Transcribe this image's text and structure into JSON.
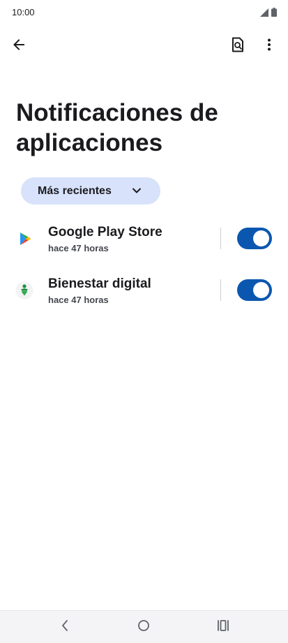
{
  "status_bar": {
    "time": "10:00",
    "icons": [
      "signal-icon",
      "battery-icon"
    ]
  },
  "top_bar": {
    "back_icon": "arrow-back-icon",
    "search_icon": "search-settings-icon",
    "more_icon": "more-vert-icon"
  },
  "page": {
    "title": "Notificaciones de aplicaciones"
  },
  "filter": {
    "selected": "Más recientes",
    "icon": "chevron-down-icon",
    "color": "#d8e2fb"
  },
  "apps": [
    {
      "name": "Google Play Store",
      "time": "hace 47 horas",
      "icon": "google-play-icon",
      "enabled": true
    },
    {
      "name": "Bienestar digital",
      "time": "hace 47 horas",
      "icon": "digital-wellbeing-icon",
      "enabled": true
    }
  ],
  "nav_bar": {
    "back_icon": "nav-back-icon",
    "home_icon": "nav-home-icon",
    "recents_icon": "nav-recents-icon"
  },
  "colors": {
    "accent": "#0b57b0",
    "text_primary": "#1b1b1f",
    "text_secondary": "#44474e"
  }
}
